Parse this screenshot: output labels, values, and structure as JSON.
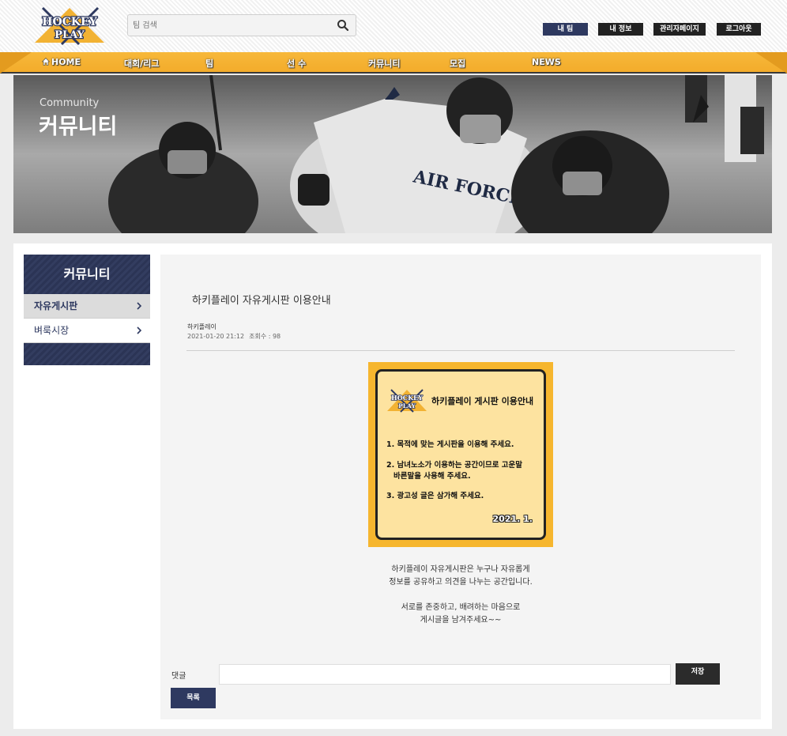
{
  "header": {
    "logo_top": "HOCKEY",
    "logo_bottom": "PLAY",
    "search_placeholder": "팀 검색",
    "buttons": {
      "my_team": "내 팀",
      "my_info": "내 정보",
      "admin": "관리자페이지",
      "logout": "로그아웃"
    }
  },
  "nav": {
    "items": [
      "HOME",
      "대회/리그",
      "팀",
      "선 수",
      "커뮤니티",
      "모집",
      "NEWS"
    ]
  },
  "banner": {
    "subtitle": "Community",
    "title": "커뮤니티"
  },
  "sidebar": {
    "title": "커뮤니티",
    "items": [
      {
        "label": "자유게시판",
        "active": true
      },
      {
        "label": "벼룩시장",
        "active": false
      }
    ]
  },
  "post": {
    "title": "하키플레이 자유게시판 이용안내",
    "author": "하키플레이",
    "datetime": "2021-01-20 21:12",
    "views": "조회수 : 98",
    "notice_image": {
      "logo_top": "HOCKEY",
      "logo_bottom": "PLAY",
      "heading": "하키플레이 게시판 이용안내",
      "rule1": "1. 목적에 맞는 게시판을 이용해 주세요.",
      "rule2_a": "2. 남녀노소가 이용하는 공간이므로 고운말",
      "rule2_b": "바른말을 사용해 주세요.",
      "rule3": "3. 광고성 글은 삼가해 주세요.",
      "date": "2021. 1."
    },
    "body_line1": "하키플레이 자유게시판은 누구나 자유롭게",
    "body_line2": "정보를 공유하고 의견을 나누는 공간입니다.",
    "body_line3": "서로를 존중하고, 배려하는 마음으로",
    "body_line4": "게시글을 남겨주세요~~"
  },
  "comment": {
    "label": "댓글",
    "value": "",
    "save_label": "저장"
  },
  "list_button": "목록",
  "colors": {
    "navy": "#2e3960",
    "orange": "#f3ac2b",
    "dark": "#222222"
  }
}
